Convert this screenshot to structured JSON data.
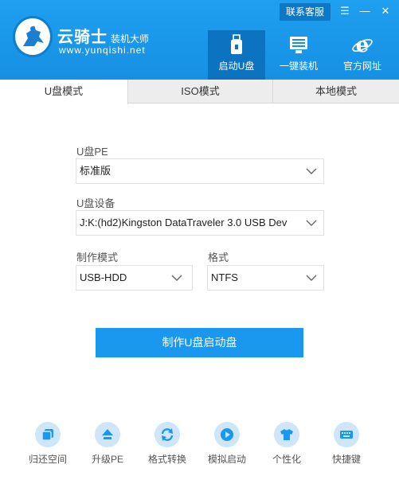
{
  "header": {
    "brand_name": "云骑士",
    "brand_sub": "装机大师",
    "brand_url": "www.yunqishi.net",
    "contact_label": "联系客服",
    "window_controls": {
      "menu": "☰",
      "minimize": "—",
      "close": "✕"
    }
  },
  "nav": [
    {
      "label": "启动U盘",
      "icon": "usb-icon",
      "active": true
    },
    {
      "label": "一键装机",
      "icon": "monitor-icon",
      "active": false
    },
    {
      "label": "官方网址",
      "icon": "ie-browser-icon",
      "active": false
    }
  ],
  "tabs": [
    {
      "label": "U盘模式",
      "active": true
    },
    {
      "label": "ISO模式",
      "active": false
    },
    {
      "label": "本地模式",
      "active": false
    }
  ],
  "form": {
    "pe_label": "U盘PE",
    "pe_value": "标准版",
    "device_label": "U盘设备",
    "device_value": "J:K:(hd2)Kingston DataTraveler 3.0 USB Dev",
    "mode_label": "制作模式",
    "mode_value": "USB-HDD",
    "format_label": "格式",
    "format_value": "NTFS"
  },
  "make_button": "制作U盘启动盘",
  "tools": [
    {
      "label": "归还空间",
      "icon": "restore-space-icon"
    },
    {
      "label": "升级PE",
      "icon": "upgrade-icon"
    },
    {
      "label": "格式转换",
      "icon": "convert-icon"
    },
    {
      "label": "模拟启动",
      "icon": "play-icon"
    },
    {
      "label": "个性化",
      "icon": "tshirt-icon"
    },
    {
      "label": "快捷键",
      "icon": "keyboard-icon"
    }
  ],
  "colors": {
    "accent": "#1a97ee",
    "header": "#1f9ff0",
    "nav_active": "#0b73c0",
    "tool_bg": "#cfe6f8",
    "tool_icon": "#1a97ee"
  }
}
